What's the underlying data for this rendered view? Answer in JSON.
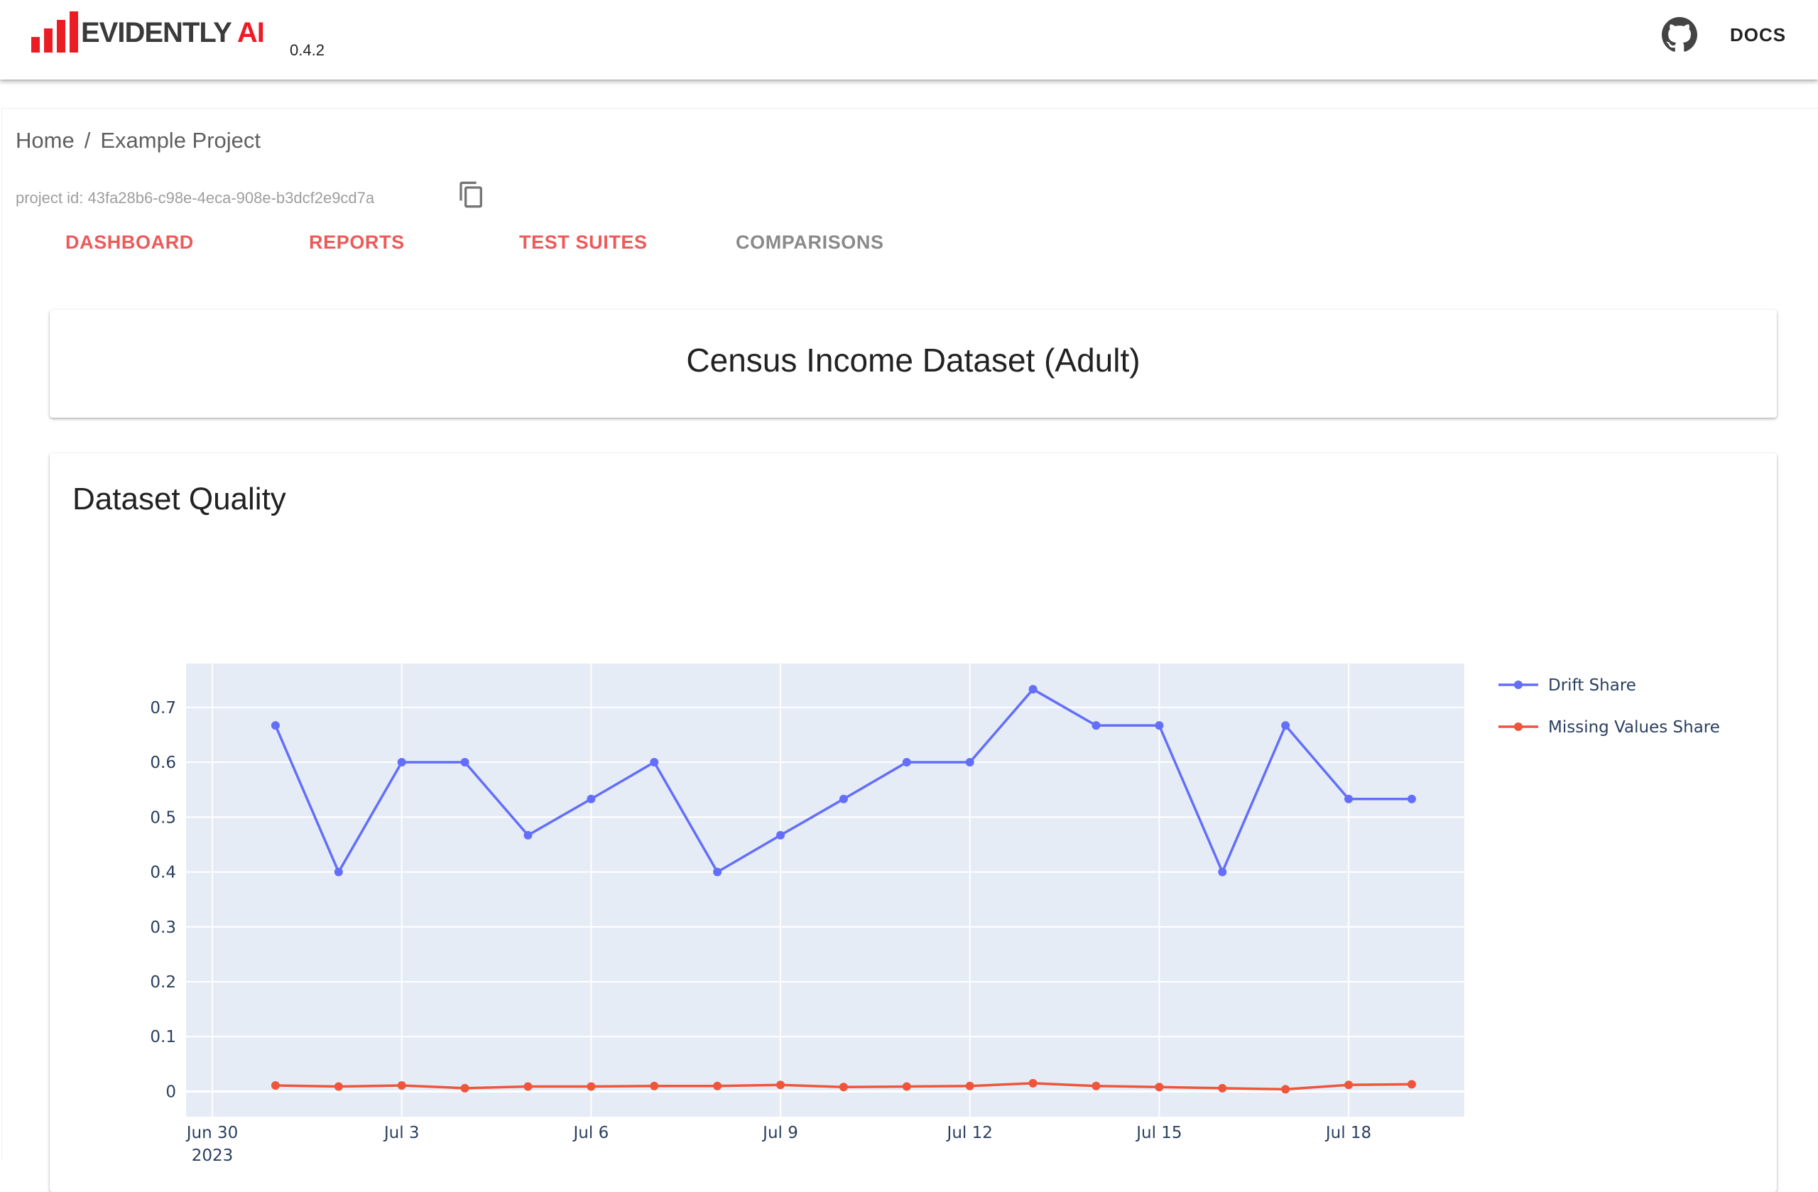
{
  "header": {
    "logo_text": "EVIDENTLY",
    "logo_ai": "AI",
    "version": "0.4.2",
    "docs_label": "DOCS",
    "github_icon": "github-icon",
    "brand_color": "#ed1b24"
  },
  "breadcrumb": {
    "home": "Home",
    "separator": "/",
    "project": "Example Project"
  },
  "project": {
    "id_text": "project id: 43fa28b6-c98e-4eca-908e-b3dcf2e9cd7a",
    "copy_icon": "copy-icon"
  },
  "tabs": [
    {
      "label": "DASHBOARD",
      "color": "#ed5a59"
    },
    {
      "label": "REPORTS",
      "color": "#ed5a59"
    },
    {
      "label": "TEST SUITES",
      "color": "#ed5a59"
    },
    {
      "label": "COMPARISONS",
      "color": "#8a8a8a"
    }
  ],
  "dashboard_title": "Census Income Dataset (Adult)",
  "chart_title": "Dataset Quality",
  "chart_data": {
    "type": "line",
    "title": "Dataset Quality",
    "xlabel": "",
    "ylabel": "",
    "x": [
      "2023-07-01",
      "2023-07-02",
      "2023-07-03",
      "2023-07-04",
      "2023-07-05",
      "2023-07-06",
      "2023-07-07",
      "2023-07-08",
      "2023-07-09",
      "2023-07-10",
      "2023-07-11",
      "2023-07-12",
      "2023-07-13",
      "2023-07-14",
      "2023-07-15",
      "2023-07-16",
      "2023-07-17",
      "2023-07-18",
      "2023-07-19"
    ],
    "series": [
      {
        "name": "Drift Share",
        "color": "#636efa",
        "values": [
          0.667,
          0.4,
          0.6,
          0.6,
          0.467,
          0.533,
          0.6,
          0.4,
          0.467,
          0.533,
          0.6,
          0.6,
          0.733,
          0.667,
          0.667,
          0.4,
          0.667,
          0.533,
          0.533
        ]
      },
      {
        "name": "Missing Values Share",
        "color": "#ef553b",
        "values": [
          0.011,
          0.009,
          0.011,
          0.006,
          0.009,
          0.009,
          0.01,
          0.01,
          0.012,
          0.008,
          0.009,
          0.01,
          0.015,
          0.01,
          0.008,
          0.006,
          0.004,
          0.012,
          0.013
        ]
      }
    ],
    "ylim": [
      -0.046,
      0.78
    ],
    "xlim": [
      "2023-06-29T14:00",
      "2023-07-19T20:00"
    ],
    "yticks": [
      "0",
      "0.1",
      "0.2",
      "0.3",
      "0.4",
      "0.5",
      "0.6",
      "0.7"
    ],
    "ytick_values": [
      0,
      0.1,
      0.2,
      0.3,
      0.4,
      0.5,
      0.6,
      0.7
    ],
    "xticks": [
      "Jun 30",
      "Jul 3",
      "Jul 6",
      "Jul 9",
      "Jul 12",
      "Jul 15",
      "Jul 18"
    ],
    "xtick_dates": [
      "2023-06-30",
      "2023-07-03",
      "2023-07-06",
      "2023-07-09",
      "2023-07-12",
      "2023-07-15",
      "2023-07-18"
    ],
    "xtick_year": "2023",
    "grid": true,
    "legend_position": "right",
    "plot_bg": "#e5ecf6"
  }
}
